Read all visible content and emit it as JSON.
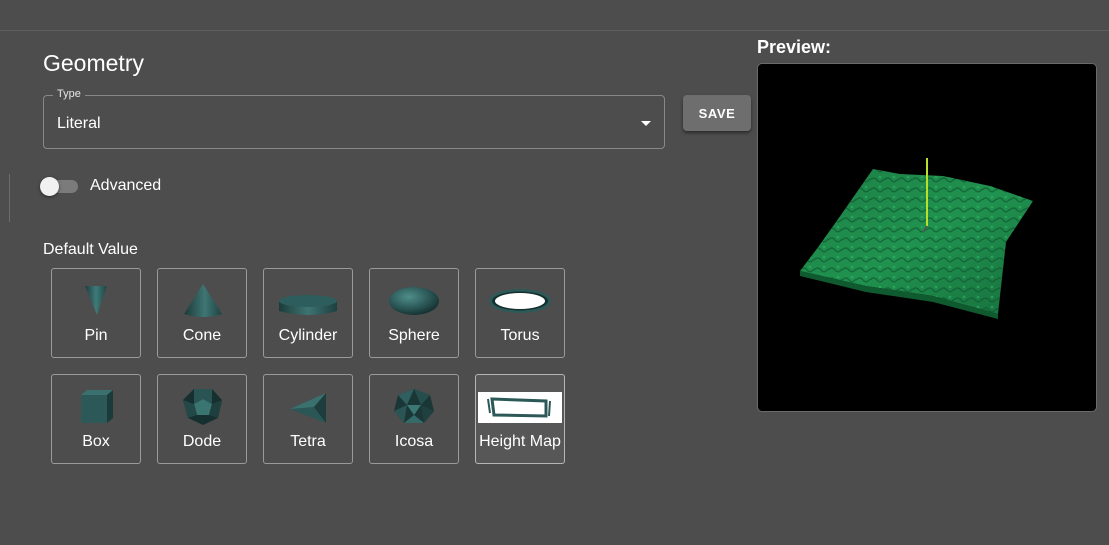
{
  "header": {
    "title": "Geometry"
  },
  "type_select": {
    "legend": "Type",
    "value": "Literal"
  },
  "save_button": {
    "label": "SAVE"
  },
  "advanced_toggle": {
    "label": "Advanced",
    "checked": false
  },
  "default_value": {
    "label": "Default Value",
    "shapes": [
      {
        "label": "Pin",
        "icon": "pin-icon"
      },
      {
        "label": "Cone",
        "icon": "cone-icon"
      },
      {
        "label": "Cylinder",
        "icon": "cylinder-icon"
      },
      {
        "label": "Sphere",
        "icon": "sphere-icon"
      },
      {
        "label": "Torus",
        "icon": "torus-icon"
      },
      {
        "label": "Box",
        "icon": "box-icon"
      },
      {
        "label": "Dode",
        "icon": "dodecahedron-icon"
      },
      {
        "label": "Tetra",
        "icon": "tetrahedron-icon"
      },
      {
        "label": "Icosa",
        "icon": "icosahedron-icon"
      },
      {
        "label": "Height Map",
        "icon": "height-map-icon",
        "selected": true
      }
    ]
  },
  "preview": {
    "title": "Preview:"
  },
  "colors": {
    "background": "#4d4d4d",
    "shape_teal": "#2e5c5c",
    "terrain_green": "#1f8a4c",
    "axis_yellow": "#b8e02a"
  }
}
